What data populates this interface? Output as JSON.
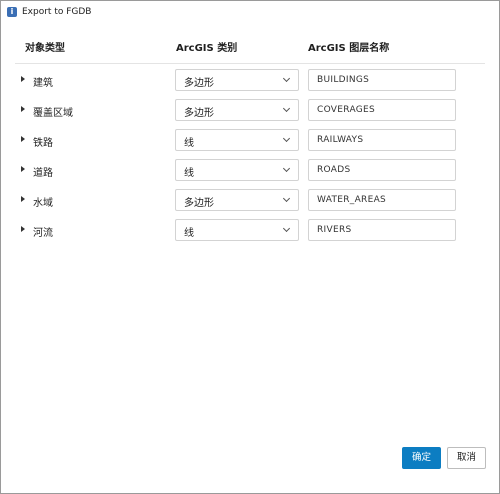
{
  "window": {
    "title": "Export to FGDB",
    "title_icon": "info-app-icon"
  },
  "columns": {
    "object_type": "对象类型",
    "arcgis_category": "ArcGIS 类别",
    "arcgis_layer_name": "ArcGIS 图层名称"
  },
  "rows": [
    {
      "label": "建筑",
      "category": "多边形",
      "layer": "BUILDINGS"
    },
    {
      "label": "覆盖区域",
      "category": "多边形",
      "layer": "COVERAGES"
    },
    {
      "label": "铁路",
      "category": "线",
      "layer": "RAILWAYS"
    },
    {
      "label": "道路",
      "category": "线",
      "layer": "ROADS"
    },
    {
      "label": "水域",
      "category": "多边形",
      "layer": "WATER_AREAS"
    },
    {
      "label": "河流",
      "category": "线",
      "layer": "RIVERS"
    }
  ],
  "buttons": {
    "ok": "确定",
    "cancel": "取消"
  },
  "colors": {
    "accent": "#0c7dc2"
  }
}
